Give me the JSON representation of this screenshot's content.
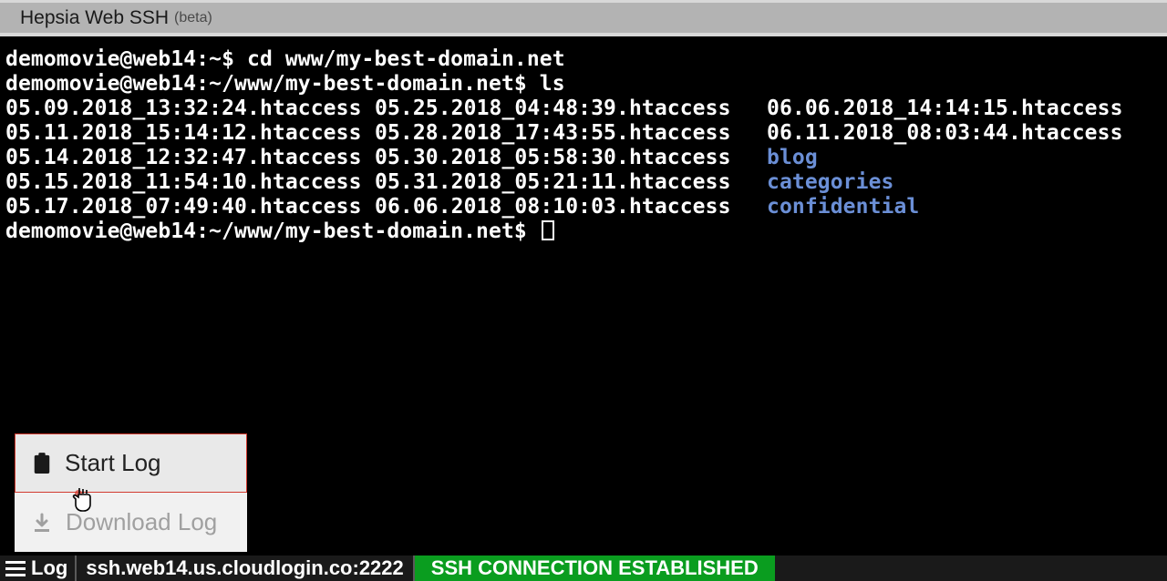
{
  "title": {
    "main": "Hepsia Web SSH",
    "sub": "(beta)"
  },
  "terminal": {
    "prompt1": "demomovie@web14:~$",
    "cmd1": "cd www/my-best-domain.net",
    "prompt2": "demomovie@web14:~/www/my-best-domain.net$",
    "cmd2": "ls",
    "ls_cols": {
      "c1": [
        "05.09.2018_13:32:24.htaccess",
        "05.11.2018_15:14:12.htaccess",
        "05.14.2018_12:32:47.htaccess",
        "05.15.2018_11:54:10.htaccess",
        "05.17.2018_07:49:40.htaccess"
      ],
      "c2": [
        "05.25.2018_04:48:39.htaccess",
        "05.28.2018_17:43:55.htaccess",
        "05.30.2018_05:58:30.htaccess",
        "05.31.2018_05:21:11.htaccess",
        "06.06.2018_08:10:03.htaccess"
      ],
      "c3": [
        "06.06.2018_14:14:15.htaccess",
        "06.11.2018_08:03:44.htaccess",
        "blog",
        "categories",
        "confidential"
      ],
      "c3_dir_from_index": 2
    },
    "prompt3": "demomovie@web14:~/www/my-best-domain.net$"
  },
  "popup": {
    "start_log": "Start Log",
    "download_log": "Download Log"
  },
  "status": {
    "log_label": "Log",
    "host": "ssh.web14.us.cloudlogin.co:2222",
    "conn": "SSH CONNECTION ESTABLISHED"
  },
  "colors": {
    "dir": "#6b8fd6",
    "conn_bg": "#0a9d1f",
    "popup_hover_border": "#d23a2f"
  }
}
